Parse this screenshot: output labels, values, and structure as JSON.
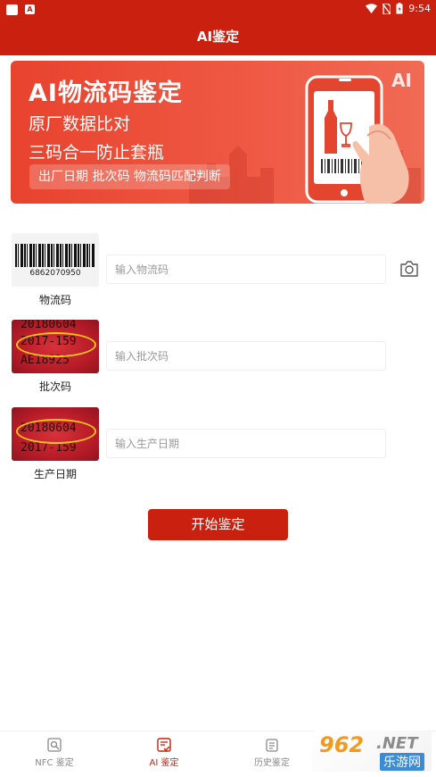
{
  "status_bar": {
    "time": "9:54"
  },
  "app_bar": {
    "title": "AI鉴定"
  },
  "banner": {
    "title": "AI物流码鉴定",
    "line1": "原厂数据比对",
    "line2": "三码合一防止套瓶",
    "tag": "出厂日期  批次码  物流码匹配判断",
    "ai_badge": "AI"
  },
  "rows": [
    {
      "thumb_text": "6862070950",
      "label": "物流码",
      "placeholder": "输入物流码"
    },
    {
      "thumb_lines": [
        "20180604",
        "2017-159",
        "AE18925"
      ],
      "label": "批次码",
      "placeholder": "输入批次码"
    },
    {
      "thumb_lines": [
        "20180604",
        "2017-159"
      ],
      "label": "生产日期",
      "placeholder": "输入生产日期"
    }
  ],
  "start_button": {
    "label": "开始鉴定"
  },
  "tabs": [
    {
      "label": "NFC 鉴定",
      "icon": "nfc-scan-icon"
    },
    {
      "label": "AI 鉴定",
      "icon": "ai-check-icon"
    },
    {
      "label": "历史鉴定",
      "icon": "history-icon"
    }
  ],
  "watermark": {
    "brand": "962",
    "suffix": ".NET",
    "site": "乐游网"
  },
  "colors": {
    "accent": "#c9200f"
  }
}
